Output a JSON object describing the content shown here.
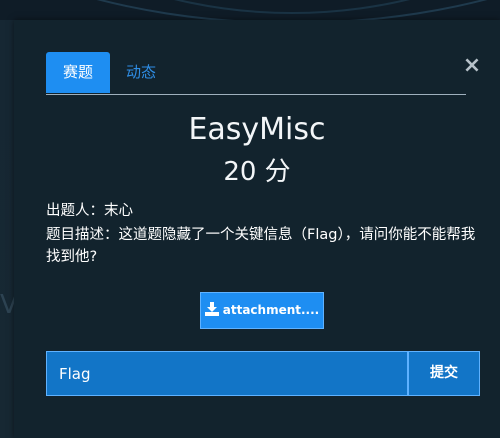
{
  "backdrop": {
    "glyph": "V"
  },
  "tabs": [
    {
      "label": "赛题",
      "active": true
    },
    {
      "label": "动态",
      "active": false
    }
  ],
  "close_label": "×",
  "challenge": {
    "name": "EasyMisc",
    "score": "20 分",
    "author_line": "出题人：末心",
    "description_line": "题目描述：这道题隐藏了一个关键信息（Flag），请问你能不能帮我找到他?"
  },
  "attachment": {
    "label": "attachment....",
    "icon": "download-icon"
  },
  "flag_form": {
    "placeholder": "Flag",
    "submit_label": "提交"
  },
  "colors": {
    "accent": "#1e8ef2",
    "input_bg": "#1275c7",
    "modal_bg": "#12232d"
  }
}
